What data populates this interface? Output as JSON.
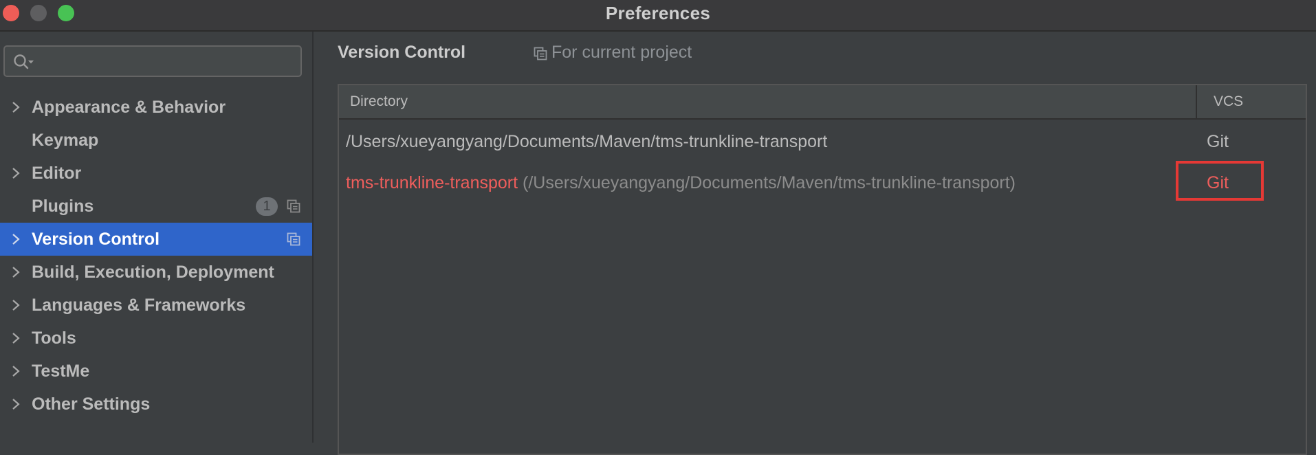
{
  "window": {
    "title": "Preferences"
  },
  "sidebar": {
    "search": {
      "value": "",
      "placeholder": ""
    },
    "items": [
      {
        "label": "Appearance & Behavior",
        "expandable": true
      },
      {
        "label": "Keymap",
        "expandable": false
      },
      {
        "label": "Editor",
        "expandable": true
      },
      {
        "label": "Plugins",
        "expandable": false,
        "badge": "1"
      },
      {
        "label": "Version Control",
        "expandable": true,
        "selected": true
      },
      {
        "label": "Build, Execution, Deployment",
        "expandable": true
      },
      {
        "label": "Languages & Frameworks",
        "expandable": true
      },
      {
        "label": "Tools",
        "expandable": true
      },
      {
        "label": "TestMe",
        "expandable": true
      },
      {
        "label": "Other Settings",
        "expandable": true
      }
    ]
  },
  "main": {
    "title": "Version Control",
    "scope_label": "For current project",
    "table": {
      "columns": [
        "Directory",
        "VCS"
      ],
      "rows": [
        {
          "directory": "/Users/xueyangyang/Documents/Maven/tms-trunkline-transport",
          "vcs": "Git"
        },
        {
          "directory_name": "tms-trunkline-transport",
          "directory_path": "(/Users/xueyangyang/Documents/Maven/tms-trunkline-transport)",
          "vcs": "Git",
          "highlighted": true
        }
      ]
    }
  },
  "colors": {
    "selection": "#2f65ca",
    "error_text": "#ef5e5c",
    "highlight_box": "#e53935"
  }
}
